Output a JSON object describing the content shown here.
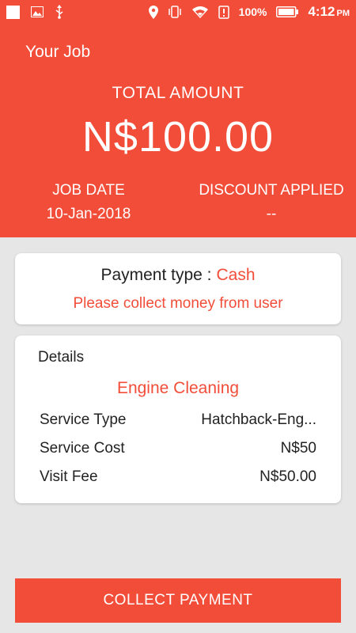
{
  "status_bar": {
    "battery_percent": "100%",
    "time": "4:12",
    "ampm": "PM",
    "icons": [
      "white-square-icon",
      "image-icon",
      "usb-icon",
      "location-icon",
      "vibrate-icon",
      "wifi-icon",
      "alert-icon",
      "battery-icon"
    ]
  },
  "header": {
    "title": "Your Job",
    "total_label": "TOTAL AMOUNT",
    "total_value": "N$100.00",
    "job_date_label": "JOB DATE",
    "job_date_value": "10-Jan-2018",
    "discount_label": "DISCOUNT APPLIED",
    "discount_value": "--"
  },
  "payment": {
    "label": "Payment type :",
    "value": "Cash",
    "message": "Please collect money from user"
  },
  "details": {
    "title": "Details",
    "service_name": "Engine Cleaning",
    "rows": [
      {
        "label": "Service Type",
        "value": "Hatchback-Eng..."
      },
      {
        "label": "Service Cost",
        "value": "N$50"
      },
      {
        "label": "Visit Fee",
        "value": "N$50.00"
      }
    ]
  },
  "actions": {
    "collect_payment_label": "COLLECT PAYMENT"
  },
  "colors": {
    "accent": "#f14d39",
    "background": "#e6e6e6",
    "card": "#ffffff"
  }
}
